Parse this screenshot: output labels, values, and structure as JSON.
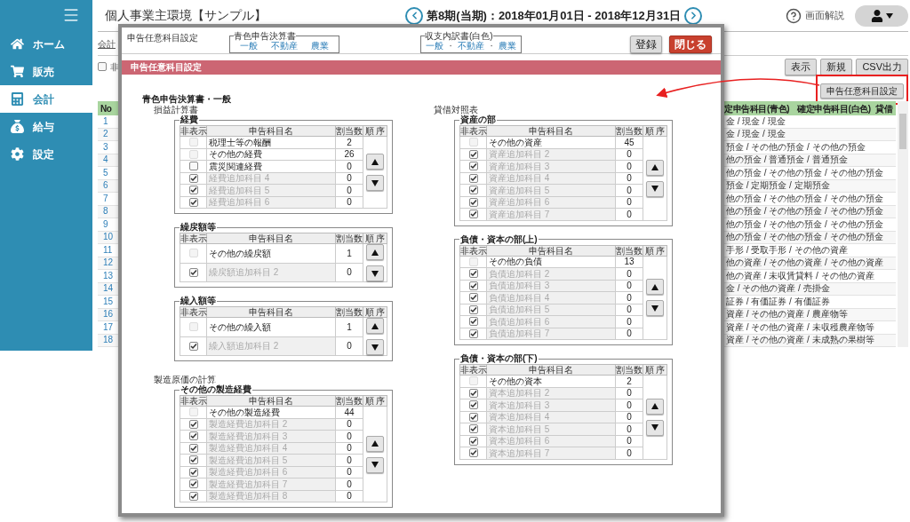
{
  "sidebar": {
    "items": [
      {
        "label": "ホーム",
        "selected": false
      },
      {
        "label": "販売",
        "selected": false
      },
      {
        "label": "会計",
        "selected": true
      },
      {
        "label": "給与",
        "selected": false
      },
      {
        "label": "設定",
        "selected": false
      }
    ]
  },
  "header": {
    "title": "個人事業主環境【サンプル】",
    "period": "第8期(当期)：2018年01月01日 - 2018年12月31日",
    "help": "画面解説"
  },
  "breadcrumb": "会計",
  "filter": {
    "label": "非",
    "checked": false
  },
  "toolbar": [
    "表示",
    "新規",
    "CSV出力"
  ],
  "settings_button": {
    "label": "申告任意科目設定",
    "highlighted": true
  },
  "table": {
    "columns": [
      "No",
      "定申告科目(青色)",
      "確定申告科目(白色)",
      "貸借"
    ],
    "rows": [
      {
        "no": "1",
        "accounts": "金 / 現金 / 現金"
      },
      {
        "no": "2",
        "accounts": "金 / 現金 / 現金"
      },
      {
        "no": "3",
        "accounts": "預金 / その他の預金 / その他の預金"
      },
      {
        "no": "4",
        "accounts": "他の預金 / 普通預金 / 普通預金"
      },
      {
        "no": "5",
        "accounts": "他の預金 / その他の預金 / その他の預金"
      },
      {
        "no": "6",
        "accounts": "預金 / 定期預金 / 定期預金"
      },
      {
        "no": "7",
        "accounts": "他の預金 / その他の預金 / その他の預金"
      },
      {
        "no": "8",
        "accounts": "他の預金 / その他の預金 / その他の預金"
      },
      {
        "no": "9",
        "accounts": "他の預金 / その他の預金 / その他の預金"
      },
      {
        "no": "10",
        "accounts": "他の預金 / その他の預金 / その他の預金"
      },
      {
        "no": "11",
        "accounts": "手形 / 受取手形 / その他の資産"
      },
      {
        "no": "12",
        "accounts": "他の資産 / その他の資産 / その他の資産"
      },
      {
        "no": "13",
        "accounts": "他の資産 / 未収賃貸料 / その他の資産"
      },
      {
        "no": "14",
        "accounts": "金 / その他の資産 / 売掛金"
      },
      {
        "no": "15",
        "accounts": "証券 / 有価証券 / 有価証券"
      },
      {
        "no": "16",
        "accounts": "資産 / その他の資産 / 農産物等"
      },
      {
        "no": "17",
        "accounts": "資産 / その他の資産 / 未収穫農産物等"
      },
      {
        "no": "18",
        "accounts": "資産 / その他の資産 / 未成熟の果樹等"
      }
    ]
  },
  "dialog": {
    "title": "申告任意科目設定",
    "forms": [
      {
        "legend": "青色申告決算書",
        "items": [
          {
            "kind": "link",
            "text": "一般"
          },
          {
            "kind": "link",
            "text": "不動産"
          },
          {
            "kind": "link",
            "text": "農業"
          }
        ]
      },
      {
        "legend": "収支内訳書(白色)",
        "items": [
          {
            "kind": "link",
            "text": "一般"
          },
          {
            "kind": "separator",
            "text": "・"
          },
          {
            "kind": "link",
            "text": "不動産"
          },
          {
            "kind": "separator",
            "text": "・"
          },
          {
            "kind": "link",
            "text": "農業"
          }
        ]
      }
    ],
    "buttons": [
      {
        "label": "登録",
        "kind": "default"
      },
      {
        "label": "閉じる",
        "kind": "danger"
      }
    ],
    "section_title": "申告任意科目設定",
    "left_column": [
      {
        "kind": "heading",
        "text": "青色申告決算書・一般"
      },
      {
        "kind": "subheading",
        "text": "損益計算書"
      },
      {
        "kind": "group",
        "legend": "経費",
        "columns": [
          "非表示",
          "申告科目名",
          "割当数",
          "順 序"
        ],
        "rows": [
          {
            "name": "税理士等の報酬",
            "count": "2",
            "checked": false,
            "disabled": true
          },
          {
            "name": "その他の経費",
            "count": "26",
            "checked": false,
            "disabled": true
          },
          {
            "name": "震災関連経費",
            "count": "0",
            "checked": false,
            "disabled": false
          },
          {
            "name": "経費追加科目 4",
            "count": "0",
            "checked": true,
            "disabled": false
          },
          {
            "name": "経費追加科目 5",
            "count": "0",
            "checked": true,
            "disabled": false
          },
          {
            "name": "経費追加科目 6",
            "count": "0",
            "checked": true,
            "disabled": false
          }
        ]
      },
      {
        "kind": "group",
        "legend": "繰戻額等",
        "columns": [
          "非表示",
          "申告科目名",
          "割当数",
          "順 序"
        ],
        "rows": [
          {
            "name": "その他の繰戻額",
            "count": "1",
            "checked": false,
            "disabled": true
          },
          {
            "name": "繰戻額追加科目 2",
            "count": "0",
            "checked": true,
            "disabled": false
          }
        ]
      },
      {
        "kind": "group",
        "legend": "繰入額等",
        "columns": [
          "非表示",
          "申告科目名",
          "割当数",
          "順 序"
        ],
        "rows": [
          {
            "name": "その他の繰入額",
            "count": "1",
            "checked": false,
            "disabled": true
          },
          {
            "name": "繰入額追加科目 2",
            "count": "0",
            "checked": true,
            "disabled": false
          }
        ]
      },
      {
        "kind": "subheading",
        "text": "製造原価の計算"
      },
      {
        "kind": "group",
        "legend": "その他の製造経費",
        "columns": [
          "非表示",
          "申告科目名",
          "割当数",
          "順 序"
        ],
        "rows": [
          {
            "name": "その他の製造経費",
            "count": "44",
            "checked": false,
            "disabled": true
          },
          {
            "name": "製造経費追加科目 2",
            "count": "0",
            "checked": true,
            "disabled": false
          },
          {
            "name": "製造経費追加科目 3",
            "count": "0",
            "checked": true,
            "disabled": false
          },
          {
            "name": "製造経費追加科目 4",
            "count": "0",
            "checked": true,
            "disabled": false
          },
          {
            "name": "製造経費追加科目 5",
            "count": "0",
            "checked": true,
            "disabled": false
          },
          {
            "name": "製造経費追加科目 6",
            "count": "0",
            "checked": true,
            "disabled": false
          },
          {
            "name": "製造経費追加科目 7",
            "count": "0",
            "checked": true,
            "disabled": false
          },
          {
            "name": "製造経費追加科目 8",
            "count": "0",
            "checked": true,
            "disabled": false
          }
        ]
      }
    ],
    "right_column": [
      {
        "kind": "subheading",
        "text": "貸借対照表"
      },
      {
        "kind": "group",
        "legend": "資産の部",
        "columns": [
          "非表示",
          "申告科目名",
          "割当数",
          "順 序"
        ],
        "rows": [
          {
            "name": "その他の資産",
            "count": "45",
            "checked": false,
            "disabled": true
          },
          {
            "name": "資産追加科目 2",
            "count": "0",
            "checked": true,
            "disabled": false
          },
          {
            "name": "資産追加科目 3",
            "count": "0",
            "checked": true,
            "disabled": false
          },
          {
            "name": "資産追加科目 4",
            "count": "0",
            "checked": true,
            "disabled": false
          },
          {
            "name": "資産追加科目 5",
            "count": "0",
            "checked": true,
            "disabled": false
          },
          {
            "name": "資産追加科目 6",
            "count": "0",
            "checked": true,
            "disabled": false
          },
          {
            "name": "資産追加科目 7",
            "count": "0",
            "checked": true,
            "disabled": false
          }
        ]
      },
      {
        "kind": "group",
        "legend": "負債・資本の部(上)",
        "columns": [
          "非表示",
          "申告科目名",
          "割当数",
          "順 序"
        ],
        "rows": [
          {
            "name": "その他の負債",
            "count": "13",
            "checked": false,
            "disabled": true
          },
          {
            "name": "負債追加科目 2",
            "count": "0",
            "checked": true,
            "disabled": false
          },
          {
            "name": "負債追加科目 3",
            "count": "0",
            "checked": true,
            "disabled": false
          },
          {
            "name": "負債追加科目 4",
            "count": "0",
            "checked": true,
            "disabled": false
          },
          {
            "name": "負債追加科目 5",
            "count": "0",
            "checked": true,
            "disabled": false
          },
          {
            "name": "負債追加科目 6",
            "count": "0",
            "checked": true,
            "disabled": false
          },
          {
            "name": "負債追加科目 7",
            "count": "0",
            "checked": true,
            "disabled": false
          }
        ]
      },
      {
        "kind": "group",
        "legend": "負債・資本の部(下)",
        "columns": [
          "非表示",
          "申告科目名",
          "割当数",
          "順 序"
        ],
        "rows": [
          {
            "name": "その他の資本",
            "count": "2",
            "checked": false,
            "disabled": true
          },
          {
            "name": "資本追加科目 2",
            "count": "0",
            "checked": true,
            "disabled": false
          },
          {
            "name": "資本追加科目 3",
            "count": "0",
            "checked": true,
            "disabled": false
          },
          {
            "name": "資本追加科目 4",
            "count": "0",
            "checked": true,
            "disabled": false
          },
          {
            "name": "資本追加科目 5",
            "count": "0",
            "checked": true,
            "disabled": false
          },
          {
            "name": "資本追加科目 6",
            "count": "0",
            "checked": true,
            "disabled": false
          },
          {
            "name": "資本追加科目 7",
            "count": "0",
            "checked": true,
            "disabled": false
          }
        ]
      }
    ]
  }
}
